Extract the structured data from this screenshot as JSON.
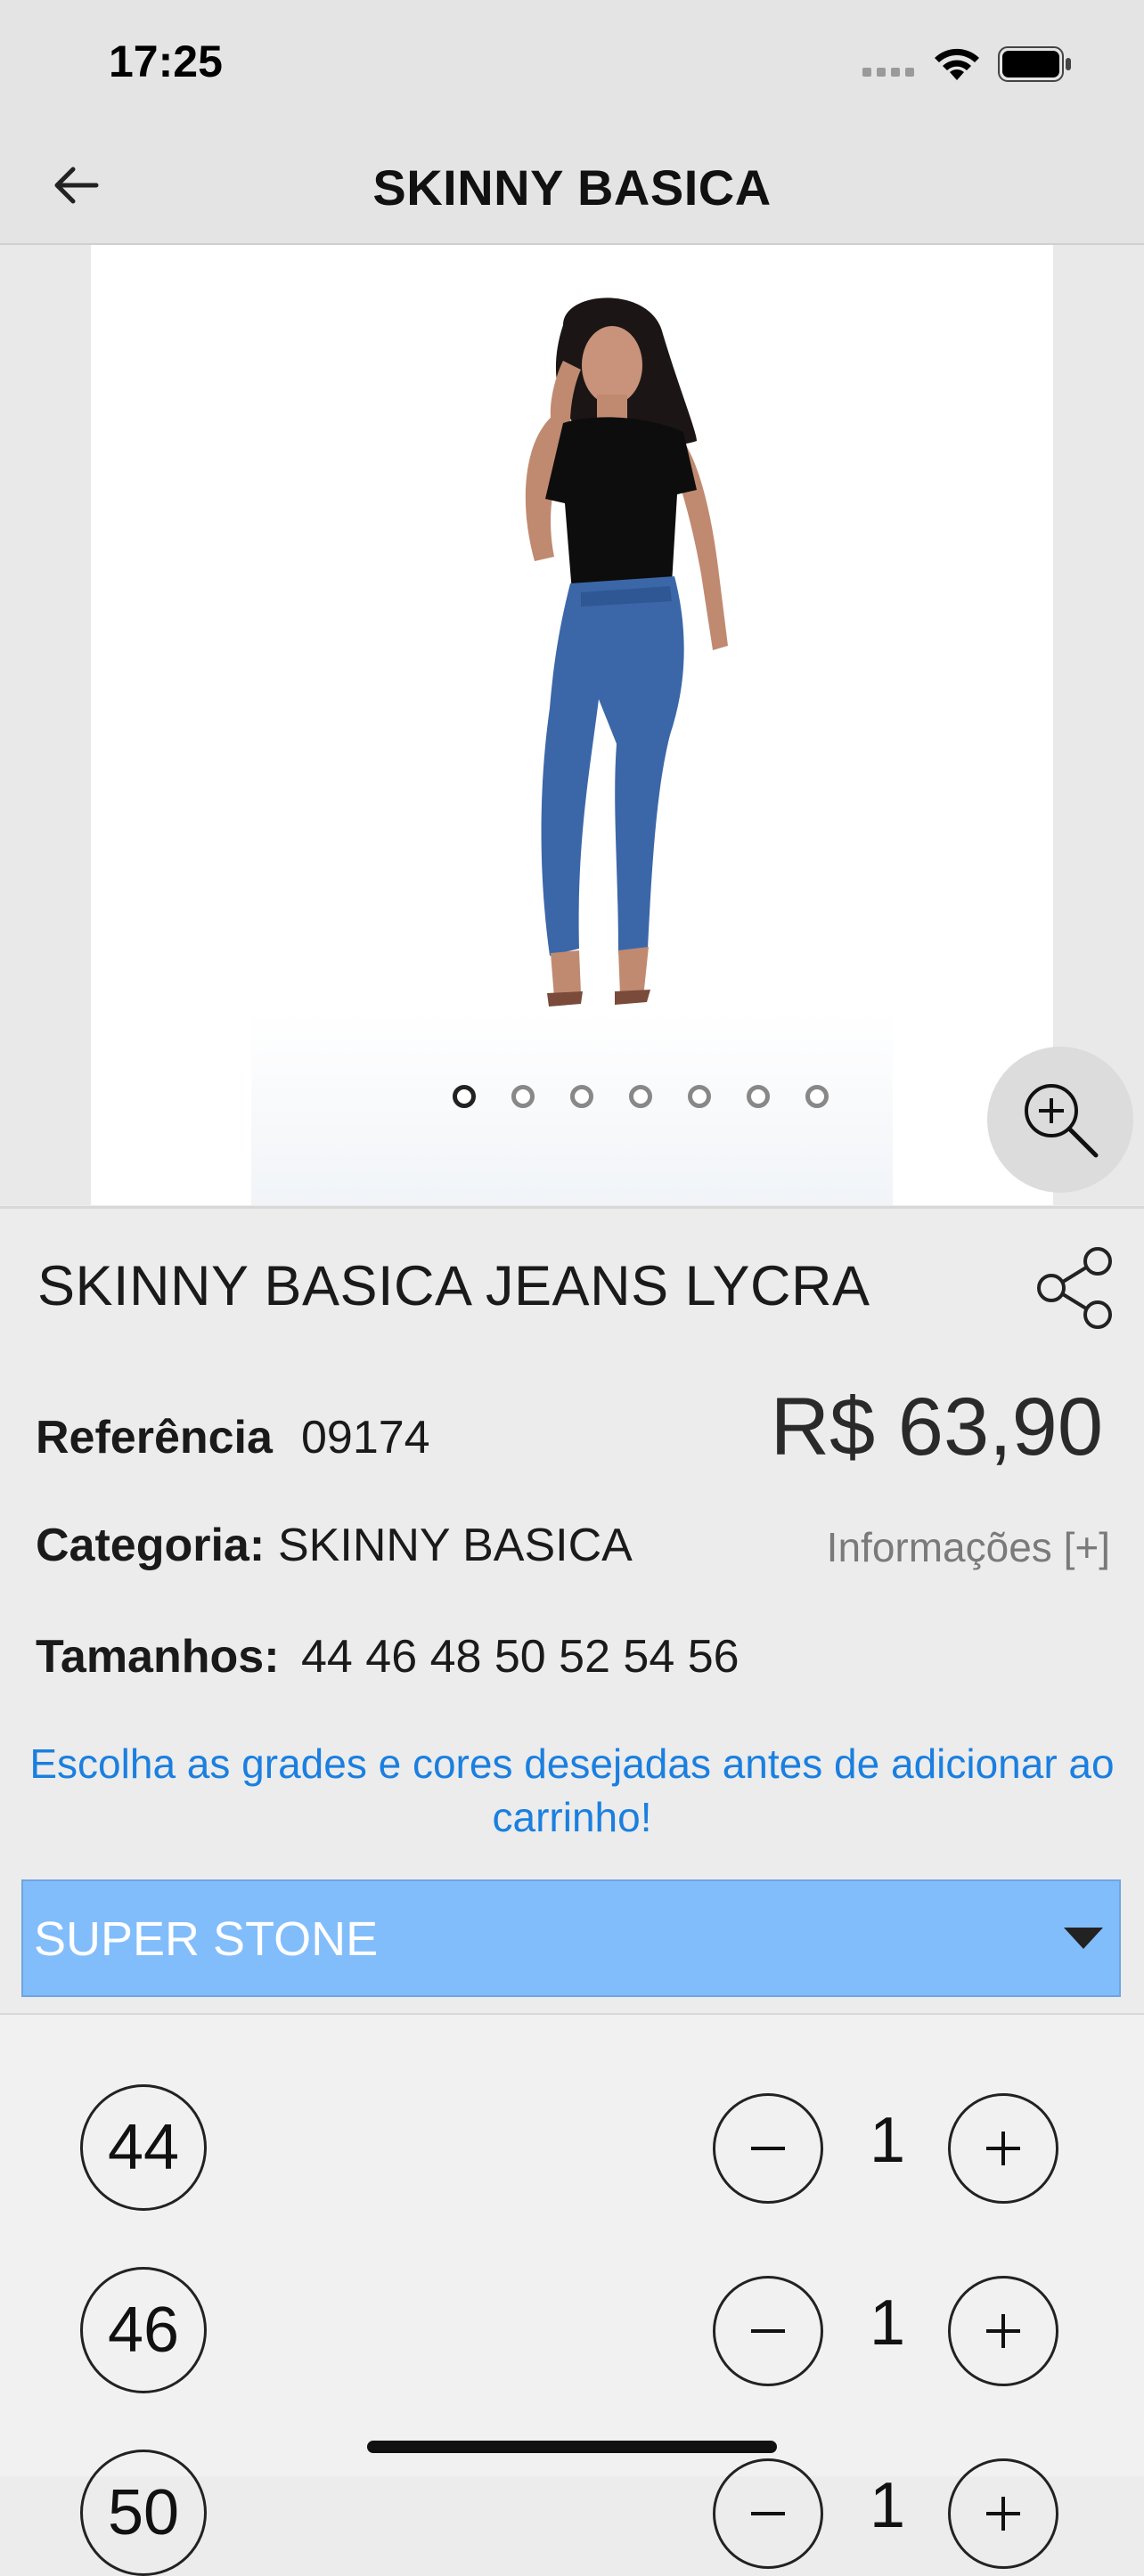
{
  "status_bar": {
    "time": "17:25"
  },
  "nav": {
    "title": "SKINNY BASICA"
  },
  "image": {
    "pages": 7,
    "active_page": 1
  },
  "product": {
    "name": "SKINNY BASICA JEANS LYCRA",
    "reference_label": "Referência",
    "reference_value": "09174",
    "price": "R$ 63,90",
    "category_label": "Categoria:",
    "category_value": "SKINNY BASICA",
    "info_link": "Informações [+]",
    "sizes_label": "Tamanhos:",
    "sizes_value": "44 46 48 50 52 54 56",
    "instruction": "Escolha as grades e cores desejadas antes de adicionar ao carrinho!"
  },
  "color_select": {
    "selected": "SUPER STONE"
  },
  "size_rows": [
    {
      "size": "44",
      "quantity": "1"
    },
    {
      "size": "46",
      "quantity": "1"
    },
    {
      "size": "50",
      "quantity": "1"
    }
  ],
  "colors": {
    "accent_blue": "#1a7fe0",
    "select_bg": "#82bdfb"
  },
  "icons": [
    "back-arrow-icon",
    "zoom-in-icon",
    "share-icon",
    "minus-icon",
    "plus-icon",
    "chevron-down-icon",
    "wifi-icon",
    "battery-icon",
    "signal-icon"
  ]
}
